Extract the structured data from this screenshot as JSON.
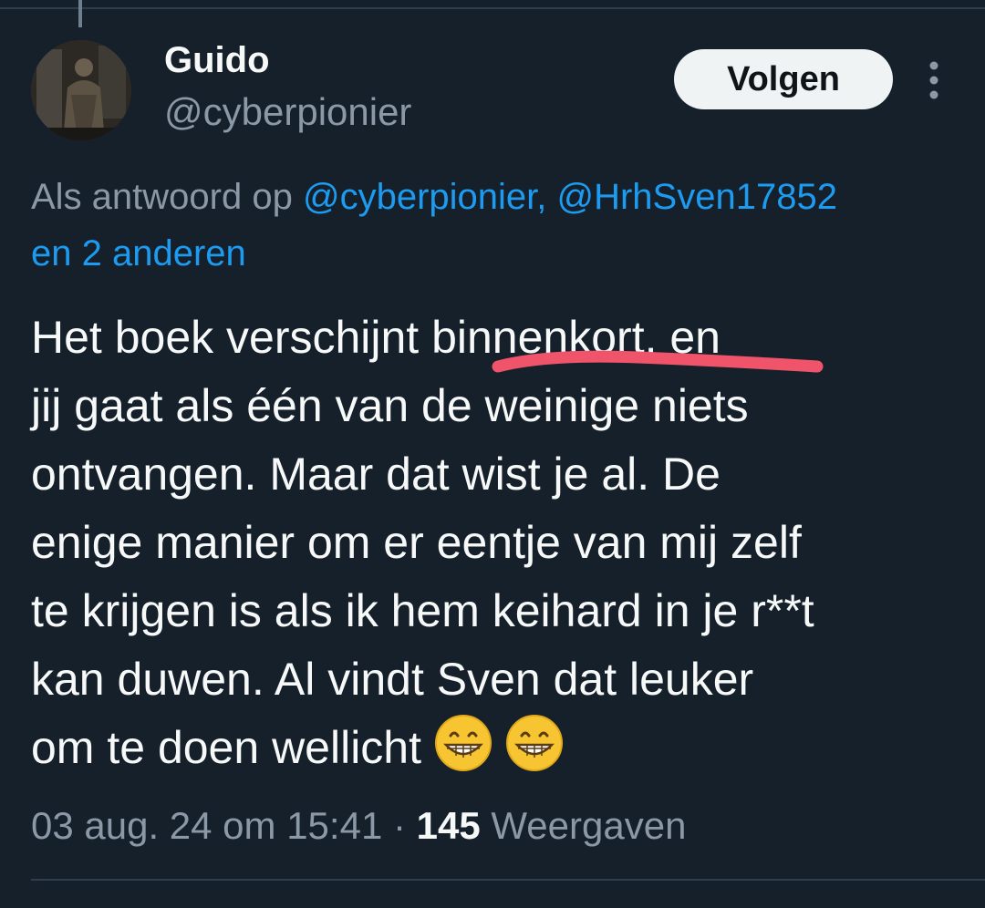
{
  "author": {
    "display_name": "Guido",
    "handle": "@cyberpionier"
  },
  "follow_button_label": "Volgen",
  "reply_context": {
    "prefix": "Als antwoord op",
    "mentions": "@cyberpionier, @HrhSven17852",
    "others": "en 2 anderen"
  },
  "tweet": {
    "line1": "Het boek verschijnt binnenkort, en",
    "line2": "jij gaat als één van de weinige niets",
    "line3": "ontvangen. Maar dat wist je al. De",
    "line4": "enige manier om er eentje van mij zelf",
    "line5": "te krijgen is als ik hem keihard in je r**t",
    "line6": "kan duwen. Al vindt Sven dat leuker",
    "line7": "om te doen wellicht",
    "emojis": [
      "grinning-face-icon",
      "grinning-face-icon"
    ]
  },
  "meta": {
    "timestamp": "03 aug. 24 om 15:41",
    "separator": "·",
    "views_count": "145",
    "views_label": "Weergaven"
  },
  "colors": {
    "background": "#15202b",
    "text": "#f7f9f9",
    "secondary": "#8b98a5",
    "link": "#1d9bf0",
    "annotation": "#f0546a"
  }
}
